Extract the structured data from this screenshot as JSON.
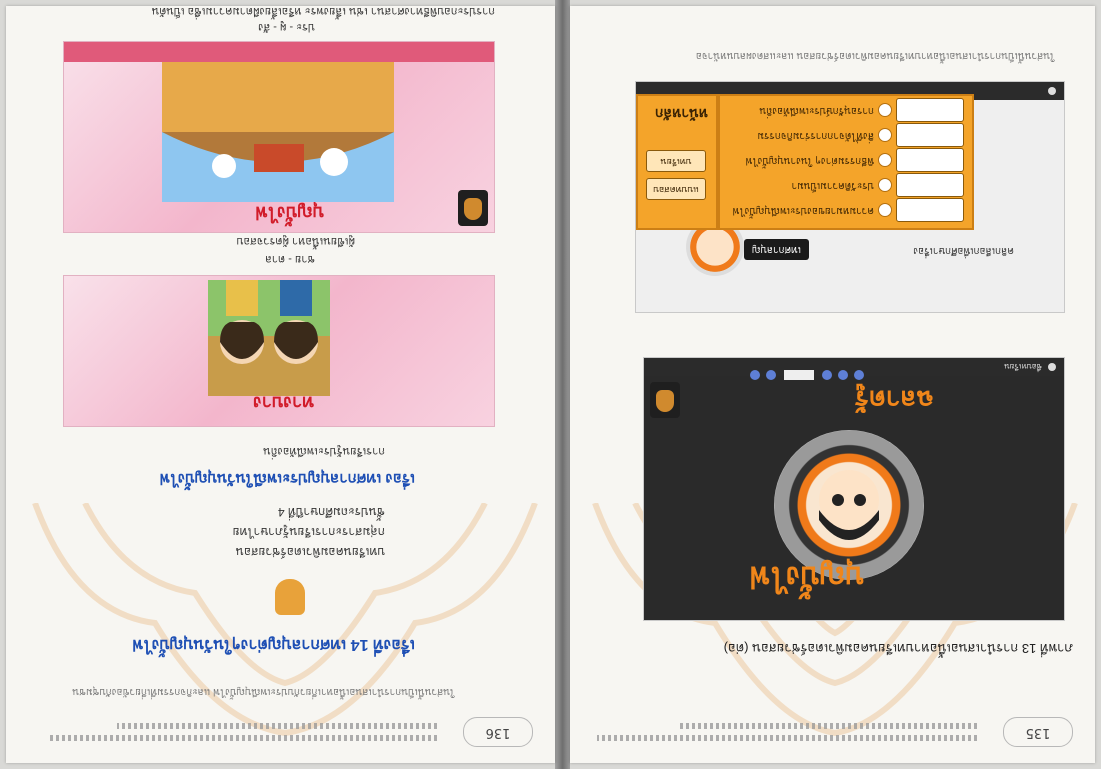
{
  "left_page": {
    "page_number": "136",
    "chapter_title": "เรื่องที่ 14 เทศกาลบุญต่างๆในวันบุญบั้งไฟ",
    "intro_lines": [
      "บทเรียนคอมพิวเตอร์ช่วยสอน",
      "กลุ่มสาระการเรียนรู้ภาษาไทย",
      "ชั้นประถมศึกษาปีที่ 4"
    ],
    "story_title": "เรื่อง เทศกาลบุญประเพณีในวันบุญบั้งไฟ",
    "story_subtitle": "การเรียนรู้ประเพณีท้องถิ่น",
    "slide2": {
      "title": "ทางบาง",
      "line1": "ชาย - ตาล",
      "line2": "ผู้เขียนเนื้อหา ผู้ตรวจสอบ"
    },
    "slide3": {
      "title": "บุญบั้งไฟ",
      "line1": "ประ - ผู - สัง",
      "line2": "การประกอบพิธีทางศาสนา เช่น เลี้ยงพระ หรือเลี้ยงผีตามความเชื่อ เป็นต้น"
    },
    "footer_note": "ในส่วนนี้เป็นการนำเสนอเนื้อหาเกี่ยวกับประเพณีบุญบั้งไฟ และกิจกรรมที่เกี่ยวข้องกับชุมชน"
  },
  "right_page": {
    "page_number": "135",
    "figure_caption": "ภาพที่ 13 การนำเสนอเนื้อหาบทเรียนคอมพิวเตอร์ช่วยสอน (ต่อ)",
    "slide1": {
      "logo_word": "บุญบั้งไฟ",
      "footer_label": "ชื่อบทเรียน",
      "orange_heading": "ฉลาดรู้"
    },
    "slide2": {
      "badge_text": "เทศกาลบุญ",
      "caption": "คลิกเลือกเพื่อศึกษาเรื่อง",
      "side_title": "หน้าหลัก",
      "side_button_1": "แบบทดสอบ",
      "side_button_2": "บทเรียน",
      "menu_items": [
        "ความหมายของประเพณีบุญบั้งไฟ",
        "ประวัติความเป็นมา",
        "พิธีกรรมต่างๆ ในงานบุญบั้งไฟ",
        "สิ่งที่ได้จากการร่วมกิจกรรม",
        "การอนุรักษ์ประเพณีท้องถิ่น"
      ]
    },
    "footer_note": "ในส่วนนี้เป็นการนำเสนอเนื้อหาบทเรียนคอมพิวเตอร์ช่วยสอน และแสดงผลบนหน้าจอ"
  },
  "colors": {
    "menu_orange": "#f4a42a",
    "title_red": "#d11c2a",
    "title_blue": "#1e4fb4",
    "slide_pink": "#f3b6cc",
    "dark_slide": "#2a2a2a"
  }
}
